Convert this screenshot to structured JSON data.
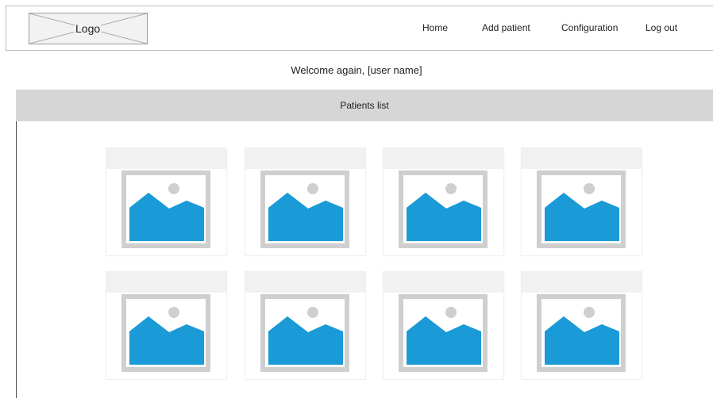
{
  "header": {
    "logo_label": "Logo",
    "nav": [
      {
        "label": "Home"
      },
      {
        "label": "Add patient"
      },
      {
        "label": "Configuration"
      },
      {
        "label": "Log out"
      }
    ]
  },
  "welcome": "Welcome again, [user name]",
  "patients_list": {
    "title": "Patients list",
    "cards": [
      {
        "icon": "image-placeholder-icon"
      },
      {
        "icon": "image-placeholder-icon"
      },
      {
        "icon": "image-placeholder-icon"
      },
      {
        "icon": "image-placeholder-icon"
      },
      {
        "icon": "image-placeholder-icon"
      },
      {
        "icon": "image-placeholder-icon"
      },
      {
        "icon": "image-placeholder-icon"
      },
      {
        "icon": "image-placeholder-icon"
      }
    ]
  },
  "colors": {
    "image_frame": "#cfcfcf",
    "image_mountain": "#1a9ad6",
    "image_sun": "#cfcfcf",
    "bar_background": "#d6d6d6",
    "card_header": "#f1f1f1"
  }
}
